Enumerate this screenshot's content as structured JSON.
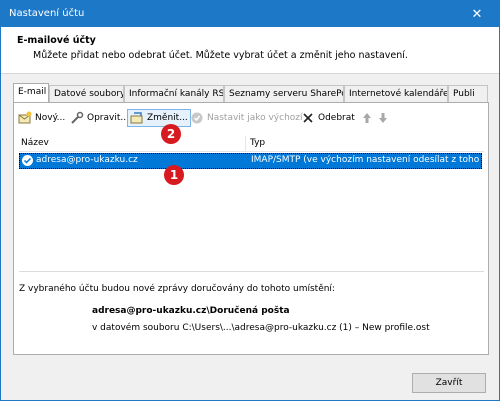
{
  "window": {
    "title": "Nastavení účtu",
    "close_glyph": "✕"
  },
  "header": {
    "title": "E-mailové účty",
    "subtitle": "Můžete přidat nebo odebrat účet. Můžete vybrat účet a změnit jeho nastavení."
  },
  "tabs": [
    {
      "label": "E-mail",
      "active": true
    },
    {
      "label": "Datové soubory"
    },
    {
      "label": "Informační kanály RSS"
    },
    {
      "label": "Seznamy serveru SharePoint"
    },
    {
      "label": "Internetové kalendáře"
    },
    {
      "label": "Publi"
    }
  ],
  "toolbar": {
    "new": "Nový...",
    "repair": "Opravit...",
    "change": "Změnit...",
    "set_default": "Nastavit jako výchozí",
    "remove": "Odebrat"
  },
  "list": {
    "headers": [
      "Název",
      "Typ"
    ],
    "rows": [
      {
        "name": "adresa@pro-ukazku.cz",
        "type": "IMAP/SMTP (ve výchozím nastavení odesílat z tohoto účtu)"
      }
    ]
  },
  "delivery": {
    "info": "Z vybraného účtu budou nové zprávy doručovány do tohoto umístění:",
    "folder": "adresa@pro-ukazku.cz\\Doručená pošta",
    "file": "v datovém souboru C:\\Users\\...\\adresa@pro-ukazku.cz (1) – New profile.ost"
  },
  "badges": {
    "one": "1",
    "two": "2"
  },
  "footer": {
    "close_label": "Zavřít"
  },
  "colors": {
    "accent": "#1e78c8",
    "selection": "#0078d7",
    "badge": "#d71920"
  }
}
